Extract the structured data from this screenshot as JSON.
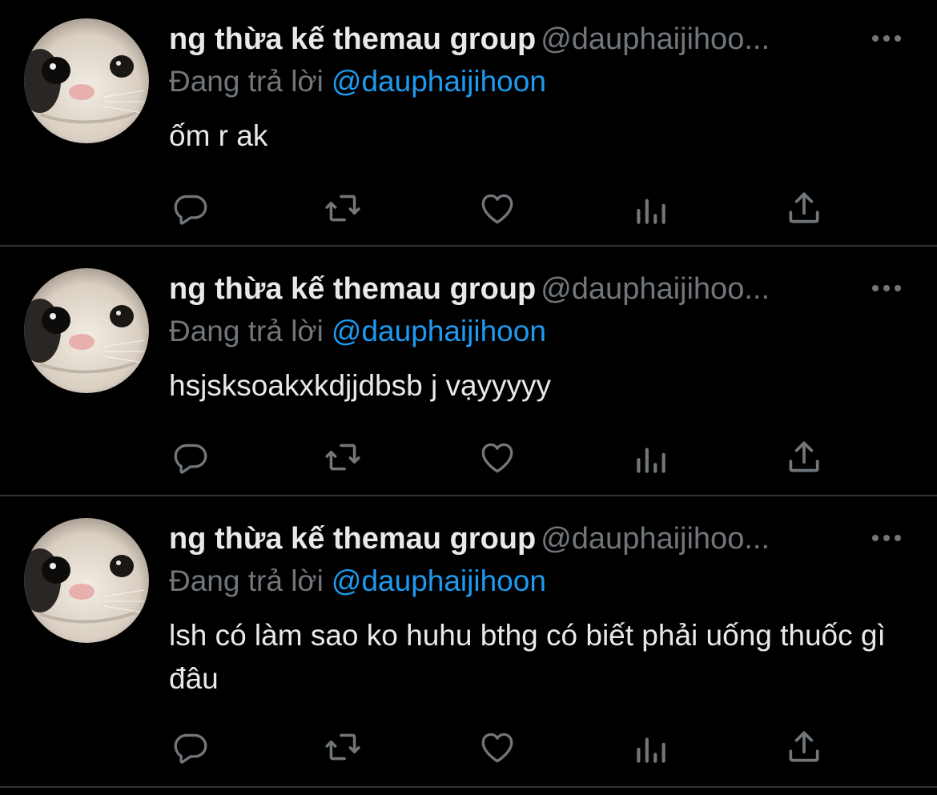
{
  "theme": {
    "background": "#000000",
    "text": "#e7e9ea",
    "muted": "#71767b",
    "link": "#1d9bf0",
    "divider": "#2f3336"
  },
  "tweets": [
    {
      "display_name": "ng thừa kế themau group",
      "handle": "@dauphaijihoo...",
      "reply_prefix": "Đang trả lời",
      "reply_to": "@dauphaijihoon",
      "text": "ốm r ak",
      "icons": [
        "reply-icon",
        "retweet-icon",
        "like-icon",
        "analytics-icon",
        "share-icon"
      ]
    },
    {
      "display_name": "ng thừa kế themau group",
      "handle": "@dauphaijihoo...",
      "reply_prefix": "Đang trả lời",
      "reply_to": "@dauphaijihoon",
      "text": "hsjsksoakxkdjjdbsb j vạyyyyy",
      "icons": [
        "reply-icon",
        "retweet-icon",
        "like-icon",
        "analytics-icon",
        "share-icon"
      ]
    },
    {
      "display_name": "ng thừa kế themau group",
      "handle": "@dauphaijihoo...",
      "reply_prefix": "Đang trả lời",
      "reply_to": "@dauphaijihoon",
      "text": "lsh có làm sao ko huhu bthg có biết phải uống thuốc gì đâu",
      "icons": [
        "reply-icon",
        "retweet-icon",
        "like-icon",
        "analytics-icon",
        "share-icon"
      ]
    }
  ]
}
